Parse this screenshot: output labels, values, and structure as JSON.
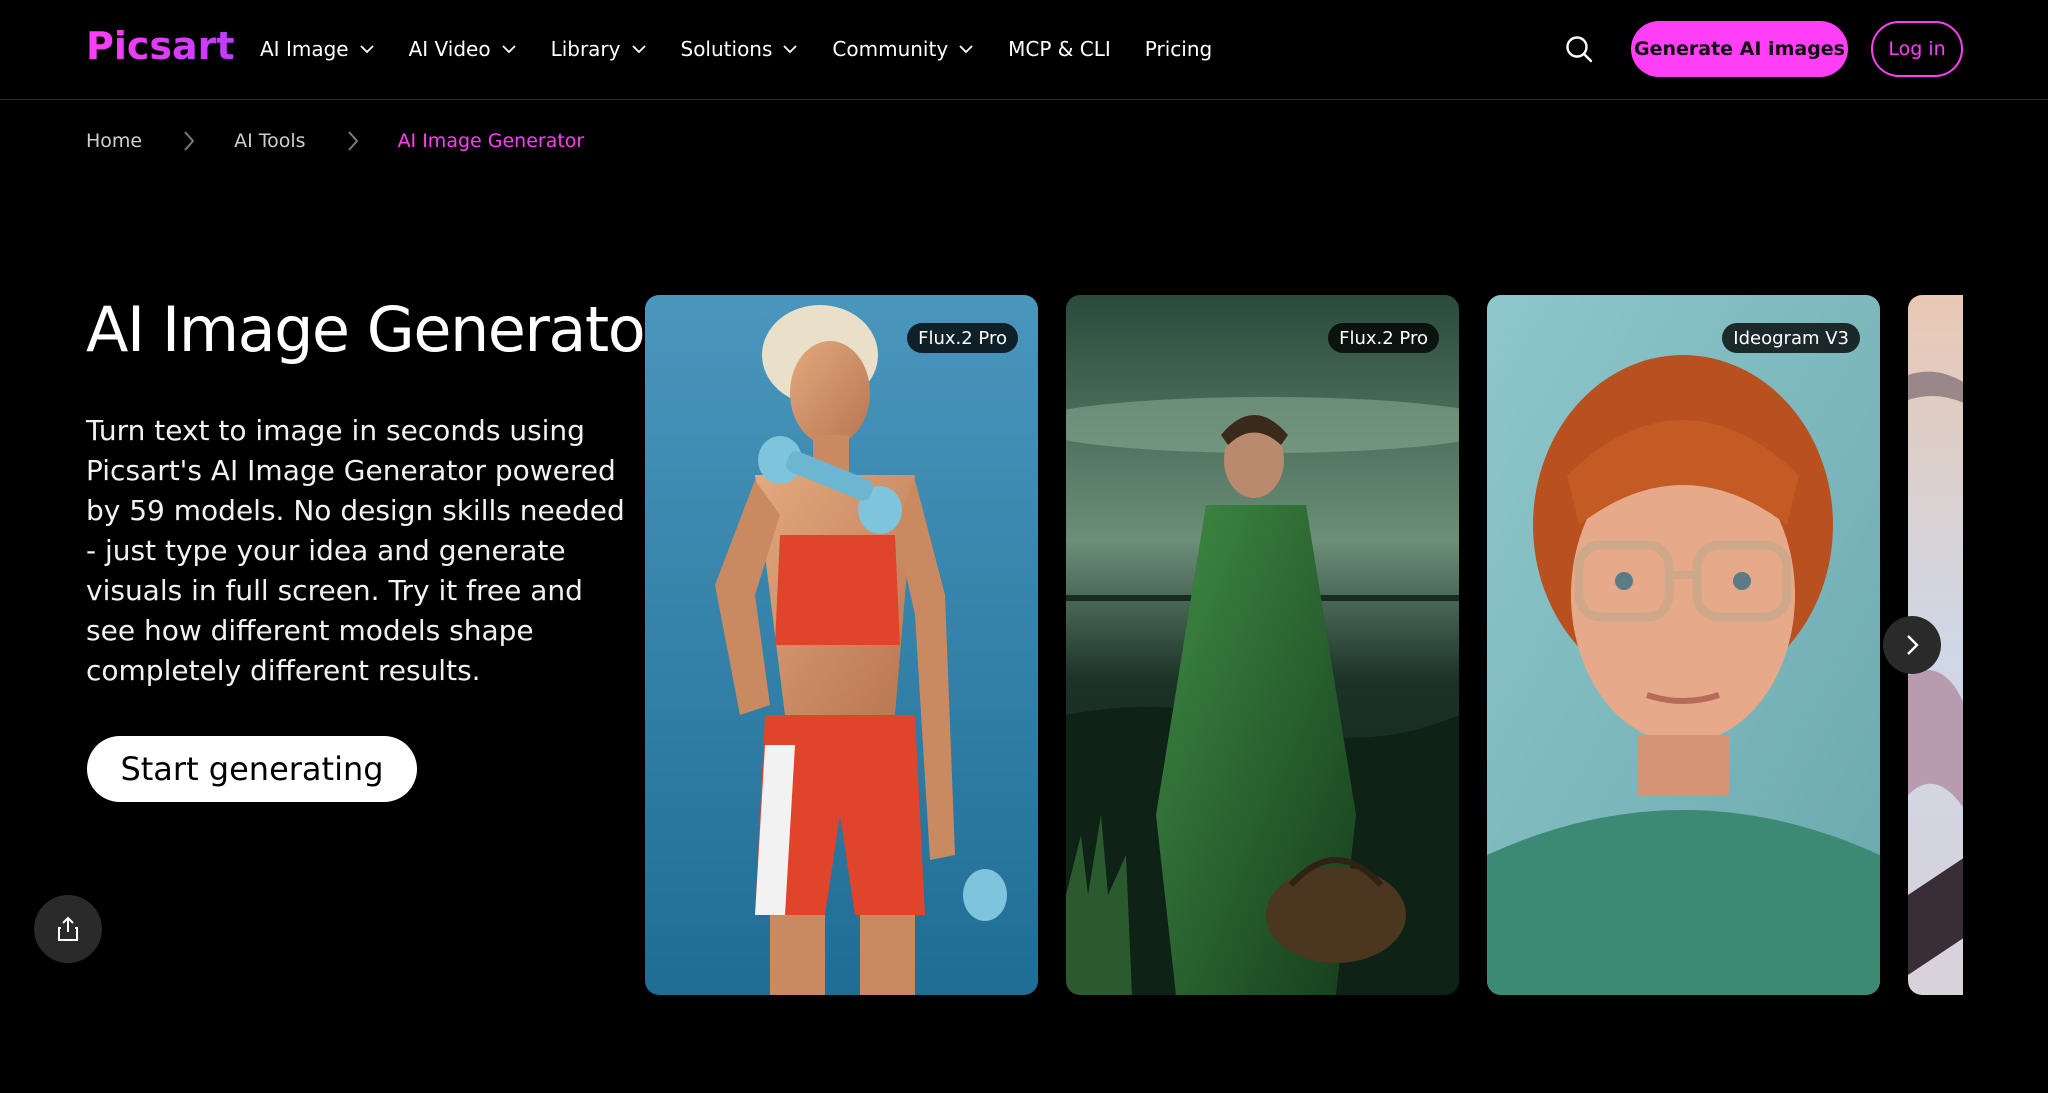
{
  "brand": {
    "logo_text": "Picsart",
    "accent_color": "#ff3ef6"
  },
  "nav": {
    "items": [
      {
        "label": "AI Image",
        "has_dropdown": true
      },
      {
        "label": "AI Video",
        "has_dropdown": true
      },
      {
        "label": "Library",
        "has_dropdown": true
      },
      {
        "label": "Solutions",
        "has_dropdown": true
      },
      {
        "label": "Community",
        "has_dropdown": true
      },
      {
        "label": "MCP & CLI",
        "has_dropdown": false
      },
      {
        "label": "Pricing",
        "has_dropdown": false
      }
    ]
  },
  "header_actions": {
    "search_icon": "search-icon",
    "generate_label": "Generate AI images",
    "login_label": "Log in"
  },
  "breadcrumb": {
    "items": [
      "Home",
      "AI Tools",
      "AI Image Generator"
    ]
  },
  "hero": {
    "title": "AI Image Generator",
    "description": "Turn text to image in seconds using Picsart's AI Image Generator powered by 59 models. No design skills needed - just type your idea and generate visuals in full screen. Try it free and see how different models shape completely different results.",
    "cta_label": "Start generating"
  },
  "carousel": {
    "cards": [
      {
        "badge": "Flux.2 Pro",
        "subject": "woman with dumbbells"
      },
      {
        "badge": "Flux.2 Pro",
        "subject": "man in green robe at lake"
      },
      {
        "badge": "Ideogram V3",
        "subject": "red-haired man with glasses"
      },
      {
        "badge": "",
        "subject": "partially visible artwork"
      }
    ],
    "next_icon": "chevron-right-icon"
  },
  "share_icon": "share-icon"
}
